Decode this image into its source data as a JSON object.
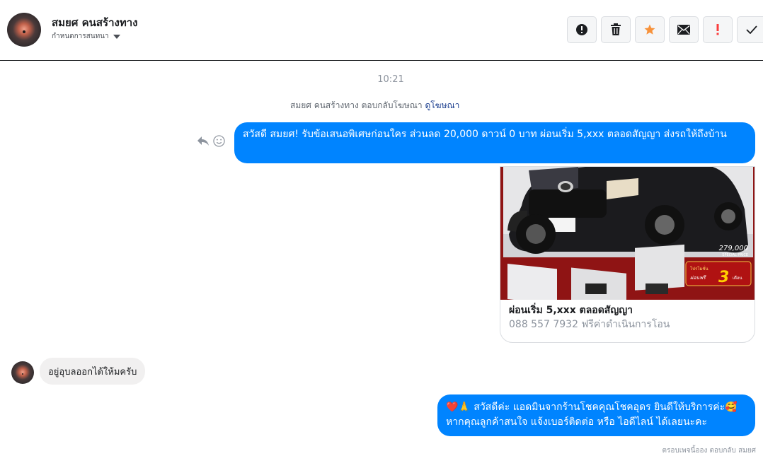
{
  "header": {
    "contact_name": "สมยศ คนสร้างทาง",
    "assign_label": "กำหนดการสนทนา",
    "actions": [
      {
        "name": "report-spam-button",
        "icon": "exclamation-circle-icon"
      },
      {
        "name": "delete-button",
        "icon": "trash-icon",
        "color": "#1c1e21"
      },
      {
        "name": "star-button",
        "icon": "star-icon",
        "color": "#f7923b"
      },
      {
        "name": "mark-unread-button",
        "icon": "envelope-icon"
      },
      {
        "name": "follow-up-button",
        "icon": "exclamation-icon",
        "color": "#fa3e3e"
      },
      {
        "name": "mark-done-button",
        "icon": "checkmark-icon"
      }
    ]
  },
  "conversation": {
    "timestamp": "10:21",
    "replied_text": "สมยศ คนสร้างทาง ตอบกลับโฆษณา",
    "replied_link": "ดูโฆษณา",
    "message1": "สวัสดี สมยศ! รับข้อเสนอพิเศษก่อนใคร ส่วนลด 20,000 ดาวน์ 0 บาท ผ่อนเริ่ม 5,xxx ตลอดสัญญา ส่งรถให้ถึงบ้าน",
    "ad_card": {
      "title": "ผ่อนเริ่ม 5,xxx ตลอดสัญญา",
      "subtitle": "088 557 7932 ฟรีค่าดำเนินการโอน",
      "price_text": "279,000",
      "price_caption": "SPECIAL PRICE",
      "promo_line1": "โปรโมชั่น",
      "promo_line2": "ผ่อนฟรี",
      "promo_number": "3",
      "promo_unit": "เดือน"
    },
    "message2": "อยู่อุบลออกได้ให้มครับ",
    "message3_line1": "❤️🙏 สวัสดีค่ะ แอดมินจากร้านโชคคุณโชคอุดร ยินดีให้บริการค่ะ🥰",
    "message3_line2": "หากคุณลูกค้าสนใจ แจ้งเบอร์ติดต่อ หรือ ไอดีไลน์ ได้เลยนะคะ",
    "footer_note": "ตรอบเพจนี้ออง ตอบกลับ สมยศ"
  },
  "colors": {
    "outgoing_bubble": "#0084ff",
    "incoming_bubble": "#f1f0f0",
    "star": "#f7923b",
    "alert": "#fa3e3e"
  }
}
